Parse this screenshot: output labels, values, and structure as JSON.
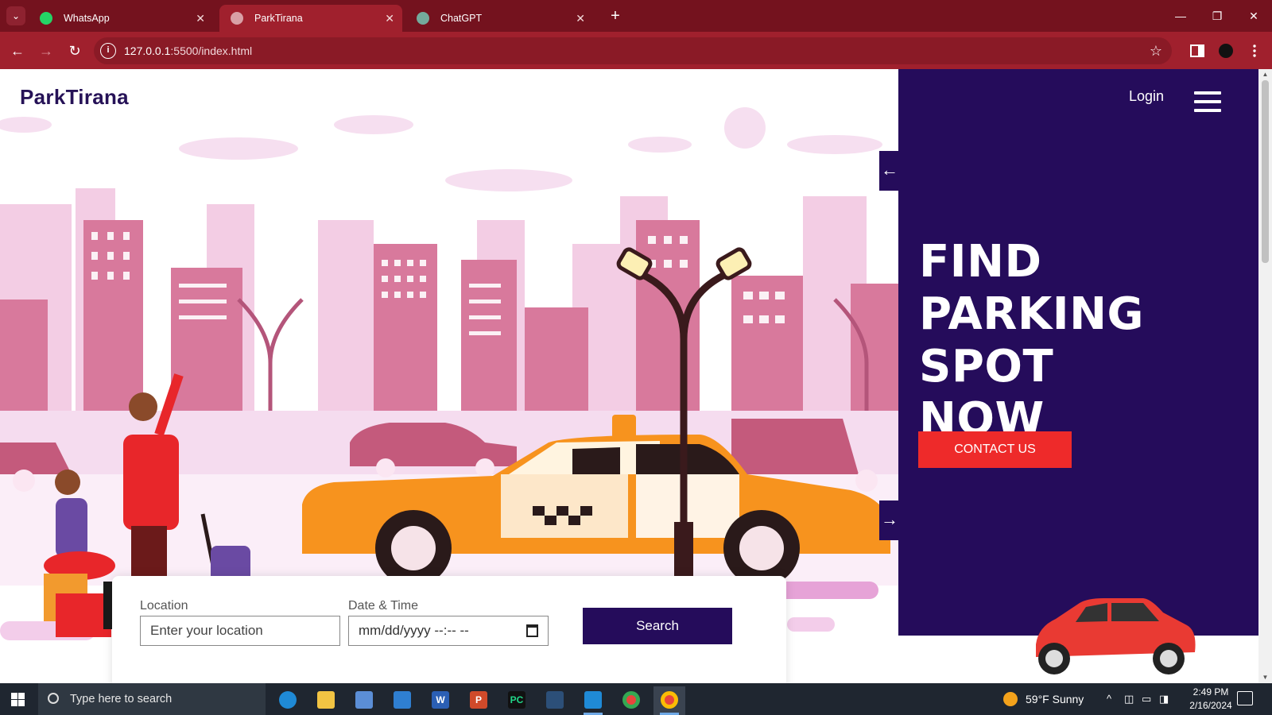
{
  "browser": {
    "tabs": [
      {
        "title": "WhatsApp",
        "active": false,
        "icon": "whatsapp-icon"
      },
      {
        "title": "ParkTirana",
        "active": true,
        "icon": "globe-icon"
      },
      {
        "title": "ChatGPT",
        "active": false,
        "icon": "chatgpt-icon"
      }
    ],
    "url_host": "127.0.0.1",
    "url_path": ":5500/index.html",
    "colors": {
      "frame": "#74121e",
      "toolbar": "#a0202d"
    }
  },
  "page": {
    "logo": "ParkTirana",
    "nav": {
      "login": "Login"
    },
    "hero": {
      "title_lines": [
        "FIND PARKING",
        "SPOT",
        "NOW"
      ],
      "cta": "CONTACT US"
    },
    "search": {
      "location_label": "Location",
      "location_placeholder": "Enter your location",
      "datetime_label": "Date & Time",
      "datetime_value": "mm/dd/yyyy --:-- --",
      "button": "Search"
    },
    "colors": {
      "brand_purple": "#250c5b",
      "cta_red": "#ee2a2a",
      "taxi_orange": "#f7931e",
      "city_pink": "#e8a7c6"
    }
  },
  "taskbar": {
    "search_placeholder": "Type here to search",
    "weather": "59°F  Sunny",
    "time": "2:49 PM",
    "date": "2/16/2024",
    "apps": [
      "edge-icon",
      "file-explorer-icon",
      "store-icon",
      "mail-icon",
      "word-icon",
      "powerpoint-icon",
      "pycharm-icon",
      "mysql-workbench-icon",
      "vscode-icon",
      "chrome-icon",
      "chrome-profile-icon"
    ]
  }
}
